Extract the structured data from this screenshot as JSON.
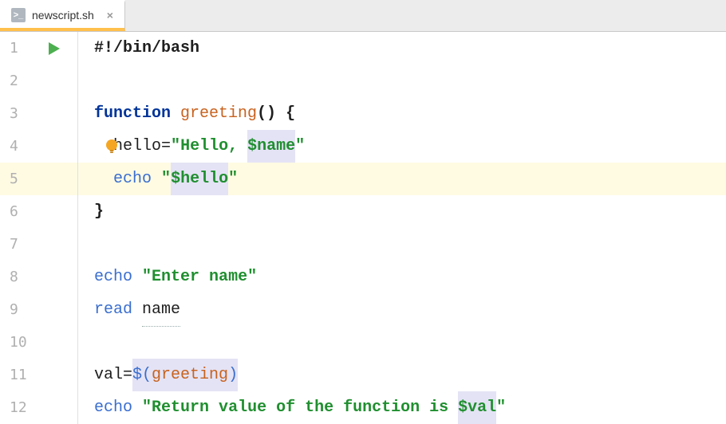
{
  "tab": {
    "filename": "newscript.sh",
    "close": "×",
    "icon_text": ">_"
  },
  "gutter": [
    "1",
    "2",
    "3",
    "4",
    "5",
    "6",
    "7",
    "8",
    "9",
    "10",
    "11",
    "12"
  ],
  "code": {
    "l1": {
      "shebang": "#!/bin/bash"
    },
    "l3": {
      "kw": "function",
      "sp": " ",
      "fn": "greeting",
      "parens": "()",
      "sp2": " ",
      "brace": "{"
    },
    "l4": {
      "indent": "  ",
      "var": "hello",
      "eq": "=",
      "q1": "\"",
      "s1": "Hello, ",
      "sv": "$name",
      "q2": "\""
    },
    "l5": {
      "indent": "  ",
      "cmd": "echo",
      "sp": " ",
      "q1": "\"",
      "sv": "$hello",
      "q2": "\""
    },
    "l6": {
      "brace": "}"
    },
    "l8": {
      "cmd": "echo",
      "sp": " ",
      "q1": "\"",
      "s": "Enter name",
      "q2": "\""
    },
    "l9": {
      "cmd": "read",
      "sp": " ",
      "arg": "name"
    },
    "l11": {
      "var": "val",
      "eq": "=",
      "open": "$(",
      "fn": "greeting",
      "close": ")"
    },
    "l12": {
      "cmd": "echo",
      "sp": " ",
      "q1": "\"",
      "s": "Return value of the function is ",
      "sv": "$val",
      "q2": "\""
    }
  },
  "highlighted_line": 5
}
